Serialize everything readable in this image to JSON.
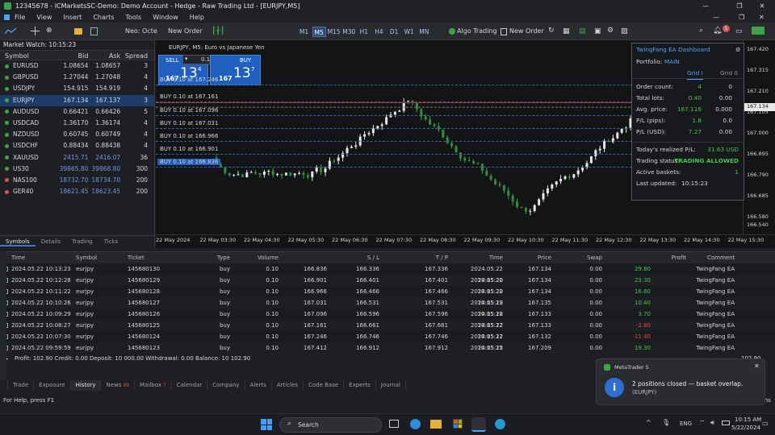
{
  "window": {
    "title": "12345678 - ICMarketsSC-Demo: Demo Account - Hedge - Raw Trading Ltd - [EURJPY,M5]"
  },
  "menu": [
    "File",
    "View",
    "Insert",
    "Charts",
    "Tools",
    "Window",
    "Help"
  ],
  "toolbar": {
    "algo_label": "Neo: Octe",
    "new_order": "New Order",
    "timeframes": [
      "M1",
      "M5",
      "M15",
      "M30",
      "H1",
      "H4",
      "D1",
      "W1",
      "MN"
    ],
    "active_tf": "M5",
    "algo_trading": "Algo Trading",
    "new_order2": "New Order",
    "notify_count": "1"
  },
  "market_watch": {
    "title": "Market Watch: 10:15:23",
    "columns": [
      "Symbol",
      "Bid",
      "Ask",
      "Spread"
    ],
    "rows": [
      {
        "symbol": "EURUSD",
        "bid": "1.08654",
        "ask": "1.08657",
        "spread": "3",
        "color": "#3ea44a"
      },
      {
        "symbol": "GBPUSD",
        "bid": "1.27044",
        "ask": "1.27048",
        "spread": "4",
        "color": "#3ea44a"
      },
      {
        "symbol": "USDJPY",
        "bid": "154.915",
        "ask": "154.919",
        "spread": "4",
        "color": "#3ea44a"
      },
      {
        "symbol": "EURJPY",
        "bid": "167.134",
        "ask": "167.137",
        "spread": "3",
        "color": "#3ea44a"
      },
      {
        "symbol": "AUDUSD",
        "bid": "0.66421",
        "ask": "0.66426",
        "spread": "5",
        "color": "#3ea44a"
      },
      {
        "symbol": "USDCAD",
        "bid": "1.36170",
        "ask": "1.36174",
        "spread": "4",
        "color": "#3ea44a"
      },
      {
        "symbol": "NZDUSD",
        "bid": "0.60745",
        "ask": "0.60749",
        "spread": "4",
        "color": "#3ea44a"
      },
      {
        "symbol": "USDCHF",
        "bid": "0.88434",
        "ask": "0.88438",
        "spread": "4",
        "color": "#3ea44a"
      },
      {
        "symbol": "XAUUSD",
        "bid": "2415.71",
        "ask": "2416.07",
        "spread": "36",
        "color": "#3ea44a"
      },
      {
        "symbol": "US30",
        "bid": "39865.80",
        "ask": "39868.80",
        "spread": "300",
        "color": "#3ea44a"
      },
      {
        "symbol": "NAS100",
        "bid": "18732.70",
        "ask": "18734.70",
        "spread": "200",
        "color": "#d9534f"
      },
      {
        "symbol": "GER40",
        "bid": "18621.45",
        "ask": "18623.45",
        "spread": "200",
        "color": "#d9534f"
      }
    ],
    "tabs": [
      "Symbols",
      "Details",
      "Trading",
      "Ticks"
    ]
  },
  "chart": {
    "symbol_title": "EURJPY, M5:  Euro vs Japanese Yen",
    "sell": {
      "label": "SELL",
      "big": "13",
      "sup": "4",
      "prefix": "167"
    },
    "buy": {
      "label": "BUY",
      "big": "13",
      "sup": "7",
      "prefix": "167"
    },
    "lot": "0.10",
    "price_ticks": [
      "167.420",
      "167.315",
      "167.210",
      "167.105",
      "167.000",
      "166.895",
      "166.790",
      "166.685",
      "166.580",
      "166.540"
    ],
    "current_price": "167.134",
    "time_ticks": [
      "22 May 2024",
      "22 May 03:30",
      "22 May 04:30",
      "22 May 05:30",
      "22 May 06:30",
      "22 May 07:30",
      "22 May 08:30",
      "22 May 09:30",
      "22 May 10:30",
      "22 May 11:30",
      "22 May 12:30",
      "22 May 13:30",
      "22 May 14:30",
      "22 May 15:30"
    ],
    "trade_lines": [
      "BUY 0.10 at 167.246",
      "BUY 0.10 at 167.161",
      "BUY 0.10 at 167.096",
      "BUY 0.10 at 167.031",
      "BUY 0.10 at 166.966",
      "BUY 0.10 at 166.901",
      "BUY 0.10 at 166.836"
    ]
  },
  "dashboard": {
    "title": "TwingFang EA Dashboard",
    "portfolio_label": "Portfolio:",
    "portfolio": "MAIN",
    "grid1": "Grid I",
    "grid2": "Grid II",
    "rows": [
      {
        "label": "Order count:",
        "v1": "4",
        "v2": "0"
      },
      {
        "label": "Total lots:",
        "v1": "0.40",
        "v2": "0.00"
      },
      {
        "label": "Avg. price:",
        "v1": "167.116",
        "v2": "0.000"
      },
      {
        "label": "P/L (pips):",
        "v1": "1.8",
        "v2": "0.0"
      },
      {
        "label": "P/L (USD):",
        "v1": "7.27",
        "v2": "0.00"
      }
    ],
    "realized_label": "Today's realized P/L:",
    "realized": "31.63 USD",
    "status_label": "Trading status:",
    "status": "TRADING ALLOWED",
    "baskets_label": "Active baskets:",
    "baskets": "1",
    "updated_label": "Last updated:",
    "updated": "10:15:23"
  },
  "terminal": {
    "columns": [
      "Time",
      "Symbol",
      "Ticket",
      "Type",
      "Volume",
      "S / L",
      "T / P",
      "Time",
      "Price",
      "Swap",
      "Profit",
      "Comment"
    ],
    "rows": [
      {
        "time": "2024.05.22 10:13:23",
        "symbol": "eurjpy",
        "ticket": "145680130",
        "type": "buy",
        "volume": "0.10",
        "price": "166.836",
        "sl": "166.336",
        "tp": "167.336",
        "time2": "2024.05.22 10:15:20",
        "price2": "167.134",
        "swap": "0.00",
        "profit": "29.80",
        "comment": "TwingFang EA"
      },
      {
        "time": "2024.05.22 10:12:28",
        "symbol": "eurjpy",
        "ticket": "145680129",
        "type": "buy",
        "volume": "0.10",
        "price": "166.901",
        "sl": "166.401",
        "tp": "167.401",
        "time2": "2024.05.22 10:15:20",
        "price2": "167.134",
        "swap": "0.00",
        "profit": "23.30",
        "comment": "TwingFang EA"
      },
      {
        "time": "2024.05.22 10:11:22",
        "symbol": "eurjpy",
        "ticket": "145680128",
        "type": "buy",
        "volume": "0.10",
        "price": "166.966",
        "sl": "166.466",
        "tp": "167.466",
        "time2": "2024.05.22 10:15:19",
        "price2": "167.134",
        "swap": "0.00",
        "profit": "16.80",
        "comment": "TwingFang EA"
      },
      {
        "time": "2024.05.22 10:10:26",
        "symbol": "eurjpy",
        "ticket": "145680127",
        "type": "buy",
        "volume": "0.10",
        "price": "167.031",
        "sl": "166.531",
        "tp": "167.531",
        "time2": "2024.05.22 10:15:18",
        "price2": "167.135",
        "swap": "0.00",
        "profit": "10.40",
        "comment": "TwingFang EA"
      },
      {
        "time": "2024.05.22 10:09:29",
        "symbol": "eurjpy",
        "ticket": "145680126",
        "type": "buy",
        "volume": "0.10",
        "price": "167.096",
        "sl": "166.596",
        "tp": "167.596",
        "time2": "2024.05.22 10:15:17",
        "price2": "167.133",
        "swap": "0.00",
        "profit": "3.70",
        "comment": "TwingFang EA"
      },
      {
        "time": "2024.05.22 10:08:27",
        "symbol": "eurjpy",
        "ticket": "145680125",
        "type": "buy",
        "volume": "0.10",
        "price": "167.161",
        "sl": "166.661",
        "tp": "167.661",
        "time2": "2024.05.22 10:15:17",
        "price2": "167.133",
        "swap": "0.00",
        "profit": "-2.80",
        "comment": "TwingFang EA"
      },
      {
        "time": "2024.05.22 10:07:30",
        "symbol": "eurjpy",
        "ticket": "145680124",
        "type": "buy",
        "volume": "0.10",
        "price": "167.246",
        "sl": "166.746",
        "tp": "167.746",
        "time2": "2024.05.22 10:15:15",
        "price2": "167.132",
        "swap": "0.00",
        "profit": "-11.40",
        "comment": "TwingFang EA"
      },
      {
        "time": "2024.05.22 09:59:59",
        "symbol": "eurjpy",
        "ticket": "145680123",
        "type": "buy",
        "volume": "0.10",
        "price": "167.412",
        "sl": "166.912",
        "tp": "167.912",
        "time2": "2024.05.22 10:02:15",
        "price2": "167.209",
        "swap": "0.00",
        "profit": "19.30",
        "comment": "TwingFang EA"
      }
    ],
    "summary": "Profit: 102.90  Credit: 0.00  Deposit: 10 000.00  Withdrawal: 0.00  Balance: 10 102.90",
    "summary_total": "102.90",
    "tabs": [
      {
        "label": "Trade"
      },
      {
        "label": "Exposure"
      },
      {
        "label": "History"
      },
      {
        "label": "News",
        "badge": "99"
      },
      {
        "label": "Mailbox",
        "badge": "7"
      },
      {
        "label": "Calendar"
      },
      {
        "label": "Company"
      },
      {
        "label": "Alerts"
      },
      {
        "label": "Articles"
      },
      {
        "label": "Code Base"
      },
      {
        "label": "Experts"
      },
      {
        "label": "Journal"
      }
    ],
    "active_tab": "History"
  },
  "status": {
    "help": "For Help, press F1",
    "net": "58.31 ms"
  },
  "toast": {
    "app": "MetaTrader 5",
    "message": "2 positions closed — basket overlap.",
    "sub": "(EURJPY)"
  },
  "taskbar": {
    "search": "Search",
    "lang": "ENG",
    "time": "10:15 AM",
    "date": "5/22/2024"
  }
}
